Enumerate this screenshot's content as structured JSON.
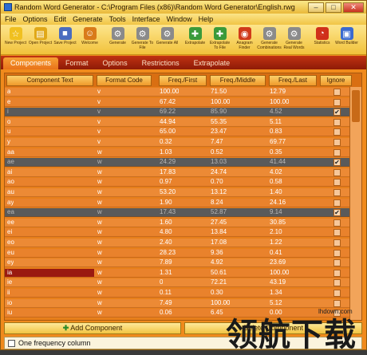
{
  "window": {
    "title": "Random Word Generator - C:\\Program Files (x86)\\Random Word Generator\\English.rwg"
  },
  "menu": [
    "File",
    "Options",
    "Edit",
    "Generate",
    "Tools",
    "Interface",
    "Window",
    "Help"
  ],
  "toolbar": [
    {
      "label": "New Project",
      "icon": "new-project-icon",
      "color": "#f0c020"
    },
    {
      "label": "Open Project",
      "icon": "open-folder-icon",
      "color": "#e0a818"
    },
    {
      "label": "Save Project",
      "icon": "save-disk-icon",
      "color": "#4a6cbf"
    },
    {
      "label": "Welcome",
      "icon": "welcome-person-icon",
      "color": "#d97b1a"
    },
    {
      "label": "Generate",
      "icon": "gear-icon",
      "color": "#8a8a8a"
    },
    {
      "label": "Generate To File",
      "icon": "gear-file-icon",
      "color": "#8a8a8a"
    },
    {
      "label": "Generate All",
      "icon": "gears-icon",
      "color": "#8a8a8a"
    },
    {
      "label": "Extrapolate",
      "icon": "extrapolate-arrows-icon",
      "color": "#3a9a3a"
    },
    {
      "label": "Extrapolate To File",
      "icon": "extrapolate-file-icon",
      "color": "#3a9a3a"
    },
    {
      "label": "Anagram Finder",
      "icon": "anagram-icon",
      "color": "#d03a1a"
    },
    {
      "label": "Generate Combinations",
      "icon": "combinations-gear-icon",
      "color": "#8a8a8a"
    },
    {
      "label": "Generate Real Words",
      "icon": "real-words-gear-icon",
      "color": "#8a8a8a"
    },
    {
      "label": "Statistics",
      "icon": "pie-chart-icon",
      "color": "#d0301a"
    },
    {
      "label": "Word Builder",
      "icon": "word-builder-icon",
      "color": "#3a6ad0"
    }
  ],
  "tabs": [
    "Components",
    "Format",
    "Options",
    "Restrictions",
    "Extrapolate"
  ],
  "columns": [
    "Component Text",
    "Format Code",
    "Freq./First",
    "Freq./Middle",
    "Freq./Last",
    "Ignore"
  ],
  "rows": [
    {
      "text": "a",
      "code": "v",
      "first": "100.00",
      "middle": "71.50",
      "last": "12.79",
      "ignore": false,
      "style": "norm"
    },
    {
      "text": "e",
      "code": "v",
      "first": "67.42",
      "middle": "100.00",
      "last": "100.00",
      "ignore": false,
      "style": "alt"
    },
    {
      "text": "i",
      "code": "v",
      "first": "69.22",
      "middle": "85.90",
      "last": "4.52",
      "ignore": true,
      "style": "dark"
    },
    {
      "text": "o",
      "code": "v",
      "first": "44.94",
      "middle": "55.35",
      "last": "5.11",
      "ignore": false,
      "style": "norm"
    },
    {
      "text": "u",
      "code": "v",
      "first": "65.00",
      "middle": "23.47",
      "last": "0.83",
      "ignore": false,
      "style": "alt"
    },
    {
      "text": "y",
      "code": "v",
      "first": "0.32",
      "middle": "7.47",
      "last": "69.77",
      "ignore": false,
      "style": "norm"
    },
    {
      "text": "aa",
      "code": "w",
      "first": "1.03",
      "middle": "0.52",
      "last": "0.35",
      "ignore": false,
      "style": "alt"
    },
    {
      "text": "ae",
      "code": "w",
      "first": "24.29",
      "middle": "13.03",
      "last": "41.44",
      "ignore": true,
      "style": "dark"
    },
    {
      "text": "ai",
      "code": "w",
      "first": "17.83",
      "middle": "24.74",
      "last": "4.02",
      "ignore": false,
      "style": "norm"
    },
    {
      "text": "ao",
      "code": "w",
      "first": "0.97",
      "middle": "0.70",
      "last": "0.58",
      "ignore": false,
      "style": "alt"
    },
    {
      "text": "au",
      "code": "w",
      "first": "53.20",
      "middle": "13.12",
      "last": "1.40",
      "ignore": false,
      "style": "norm"
    },
    {
      "text": "ay",
      "code": "w",
      "first": "1.90",
      "middle": "8.24",
      "last": "24.16",
      "ignore": false,
      "style": "alt"
    },
    {
      "text": "ea",
      "code": "w",
      "first": "17.43",
      "middle": "52.87",
      "last": "9.14",
      "ignore": true,
      "style": "dark"
    },
    {
      "text": "ee",
      "code": "w",
      "first": "1.60",
      "middle": "27.45",
      "last": "30.85",
      "ignore": false,
      "style": "norm"
    },
    {
      "text": "ei",
      "code": "w",
      "first": "4.80",
      "middle": "13.84",
      "last": "2.10",
      "ignore": false,
      "style": "alt"
    },
    {
      "text": "eo",
      "code": "w",
      "first": "2.40",
      "middle": "17.08",
      "last": "1.22",
      "ignore": false,
      "style": "norm"
    },
    {
      "text": "eu",
      "code": "w",
      "first": "28.23",
      "middle": "9.36",
      "last": "0.41",
      "ignore": false,
      "style": "alt"
    },
    {
      "text": "ey",
      "code": "w",
      "first": "7.89",
      "middle": "4.92",
      "last": "23.69",
      "ignore": false,
      "style": "norm"
    },
    {
      "text": "ia",
      "code": "w",
      "first": "1.31",
      "middle": "50.61",
      "last": "100.00",
      "ignore": false,
      "style": "alt",
      "highlight": true
    },
    {
      "text": "ie",
      "code": "w",
      "first": "0",
      "middle": "72.21",
      "last": "43.19",
      "ignore": false,
      "style": "norm"
    },
    {
      "text": "ii",
      "code": "w",
      "first": "0.11",
      "middle": "0.30",
      "last": "1.34",
      "ignore": false,
      "style": "alt"
    },
    {
      "text": "io",
      "code": "w",
      "first": "7.49",
      "middle": "100.00",
      "last": "5.12",
      "ignore": false,
      "style": "norm"
    },
    {
      "text": "iu",
      "code": "w",
      "first": "0.06",
      "middle": "6.45",
      "last": "0.00",
      "ignore": false,
      "style": "alt"
    }
  ],
  "buttons": {
    "add": "Add Component",
    "delete": "Delete Component"
  },
  "status": {
    "checkbox_label": "One frequency column"
  },
  "watermark": {
    "url": "lhdown.com",
    "text": "领航下载"
  },
  "colors": {
    "accent": "#f08a1c",
    "tab_bar": "#a8240b",
    "ignored_row": "#5a5a5a",
    "highlight": "#9a1a10"
  }
}
